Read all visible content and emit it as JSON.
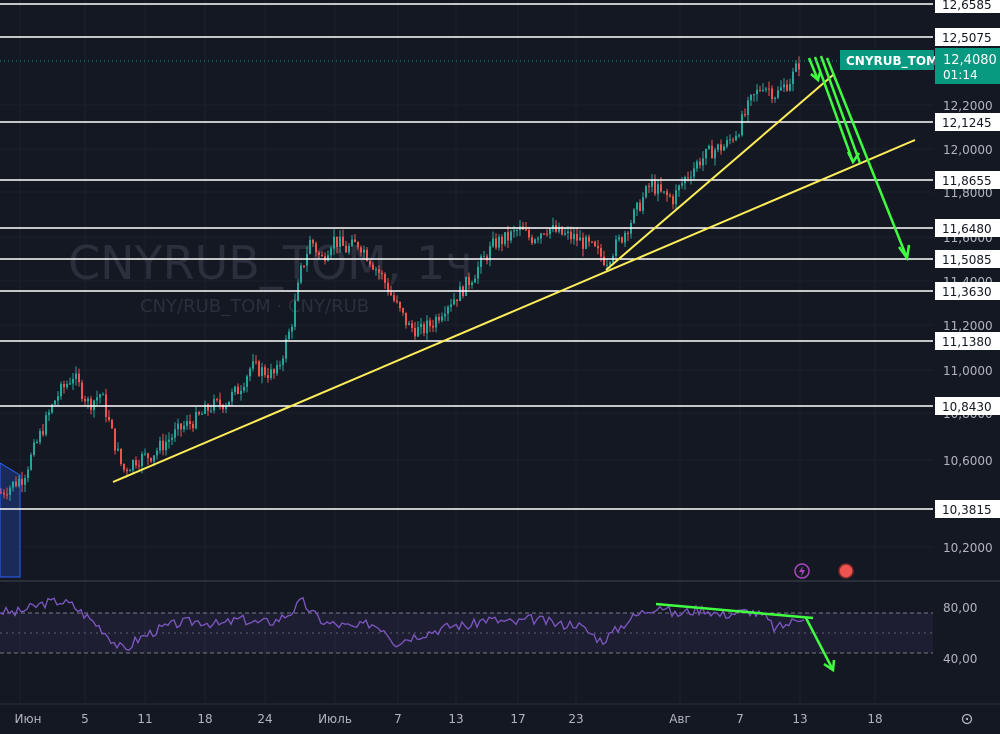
{
  "chart_data": {
    "type": "candlestick",
    "symbol_watermark": "CNYRUB_TOM, 1ч",
    "description_watermark": "CNY/RUB_TOM · CNY/RUB",
    "price_axis": {
      "ylim": [
        10.08,
        12.7
      ],
      "ticks": [
        "12,6585",
        "12,4000",
        "12,2000",
        "12,0000",
        "11,8000",
        "11,6000",
        "11,4000",
        "11,2000",
        "11,0000",
        "10,8000",
        "10,6000",
        "10,2000"
      ]
    },
    "horizontal_levels": [
      "12,6585",
      "12,5075",
      "12,1245",
      "11,8655",
      "11,6480",
      "11,5085",
      "11,3630",
      "11,1380",
      "10,8430",
      "10,3815"
    ],
    "current_price": {
      "symbol": "CNYRUB_TOM",
      "price": "12,4080",
      "countdown": "01:14"
    },
    "time_axis": {
      "labels": [
        "Июн",
        "5",
        "11",
        "18",
        "24",
        "Июль",
        "7",
        "13",
        "17",
        "23",
        "Авг",
        "7",
        "13",
        "18"
      ]
    },
    "price_path": [
      [
        0,
        10.45
      ],
      [
        22,
        10.52
      ],
      [
        40,
        10.72
      ],
      [
        55,
        10.88
      ],
      [
        72,
        10.98
      ],
      [
        88,
        10.85
      ],
      [
        100,
        10.9
      ],
      [
        112,
        10.7
      ],
      [
        122,
        10.55
      ],
      [
        135,
        10.6
      ],
      [
        150,
        10.62
      ],
      [
        165,
        10.68
      ],
      [
        180,
        10.74
      ],
      [
        195,
        10.78
      ],
      [
        210,
        10.84
      ],
      [
        225,
        10.86
      ],
      [
        238,
        10.92
      ],
      [
        250,
        11.02
      ],
      [
        262,
        11.0
      ],
      [
        275,
        10.98
      ],
      [
        290,
        11.2
      ],
      [
        300,
        11.45
      ],
      [
        310,
        11.6
      ],
      [
        320,
        11.5
      ],
      [
        332,
        11.6
      ],
      [
        345,
        11.55
      ],
      [
        358,
        11.58
      ],
      [
        370,
        11.5
      ],
      [
        382,
        11.42
      ],
      [
        395,
        11.3
      ],
      [
        408,
        11.2
      ],
      [
        420,
        11.18
      ],
      [
        432,
        11.22
      ],
      [
        445,
        11.3
      ],
      [
        458,
        11.35
      ],
      [
        470,
        11.42
      ],
      [
        482,
        11.5
      ],
      [
        494,
        11.58
      ],
      [
        506,
        11.6
      ],
      [
        518,
        11.64
      ],
      [
        530,
        11.6
      ],
      [
        545,
        11.65
      ],
      [
        560,
        11.62
      ],
      [
        575,
        11.6
      ],
      [
        590,
        11.56
      ],
      [
        605,
        11.5
      ],
      [
        620,
        11.6
      ],
      [
        635,
        11.72
      ],
      [
        650,
        11.85
      ],
      [
        660,
        11.8
      ],
      [
        672,
        11.78
      ],
      [
        685,
        11.88
      ],
      [
        698,
        11.95
      ],
      [
        712,
        12.0
      ],
      [
        725,
        12.02
      ],
      [
        738,
        12.1
      ],
      [
        750,
        12.22
      ],
      [
        762,
        12.3
      ],
      [
        775,
        12.25
      ],
      [
        790,
        12.32
      ],
      [
        800,
        12.41
      ]
    ],
    "rsi": {
      "ticks": [
        "80,00",
        "40,00"
      ],
      "upper": 70,
      "lower": 30,
      "ylim": [
        10,
        100
      ]
    },
    "rsi_path": [
      [
        0,
        72
      ],
      [
        15,
        70
      ],
      [
        30,
        75
      ],
      [
        45,
        80
      ],
      [
        60,
        82
      ],
      [
        72,
        78
      ],
      [
        85,
        68
      ],
      [
        100,
        56
      ],
      [
        115,
        40
      ],
      [
        125,
        32
      ],
      [
        135,
        42
      ],
      [
        150,
        50
      ],
      [
        165,
        56
      ],
      [
        180,
        60
      ],
      [
        200,
        62
      ],
      [
        220,
        58
      ],
      [
        240,
        64
      ],
      [
        258,
        60
      ],
      [
        275,
        62
      ],
      [
        290,
        70
      ],
      [
        302,
        82
      ],
      [
        312,
        70
      ],
      [
        325,
        60
      ],
      [
        340,
        58
      ],
      [
        355,
        55
      ],
      [
        370,
        60
      ],
      [
        385,
        54
      ],
      [
        395,
        40
      ],
      [
        410,
        46
      ],
      [
        425,
        50
      ],
      [
        440,
        54
      ],
      [
        455,
        58
      ],
      [
        470,
        57
      ],
      [
        485,
        64
      ],
      [
        500,
        62
      ],
      [
        515,
        60
      ],
      [
        530,
        64
      ],
      [
        545,
        62
      ],
      [
        560,
        58
      ],
      [
        575,
        60
      ],
      [
        590,
        50
      ],
      [
        602,
        42
      ],
      [
        615,
        52
      ],
      [
        630,
        64
      ],
      [
        645,
        72
      ],
      [
        660,
        78
      ],
      [
        675,
        68
      ],
      [
        690,
        72
      ],
      [
        705,
        74
      ],
      [
        720,
        68
      ],
      [
        735,
        70
      ],
      [
        750,
        72
      ],
      [
        765,
        66
      ],
      [
        775,
        54
      ],
      [
        790,
        60
      ],
      [
        805,
        68
      ]
    ],
    "colors": {
      "background": "#141823",
      "up": "#26a69a",
      "down": "#ef5350",
      "rsi_line": "#7e57c2",
      "trendline": "#ffee58",
      "arrow": "#40ff40",
      "level": "#ffffff",
      "price_badge": "#089981"
    }
  }
}
